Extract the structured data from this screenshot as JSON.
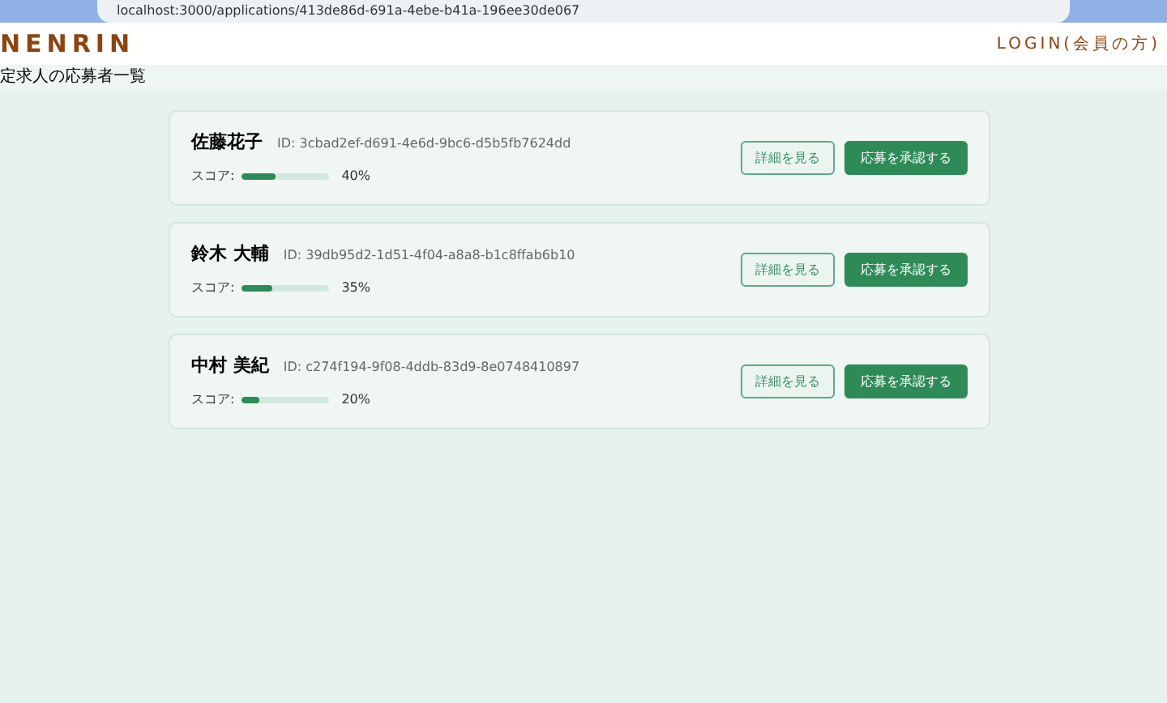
{
  "browser": {
    "url": "localhost:3000/applications/413de86d-691a-4ebe-b41a-196ee30de067"
  },
  "header": {
    "logo": "NENRIN",
    "login_link": "LOGIN(会員の方)"
  },
  "page_title": "定求人の応募者一覧",
  "applicants": [
    {
      "name": "佐藤花子",
      "id": "ID: 3cbad2ef-d691-4e6d-9bc6-d5b5fb7624dd",
      "score_label": "スコア:",
      "level": 0.4,
      "score": "40%",
      "details_button": "詳細を見る",
      "approve_button": "応募を承認する"
    },
    {
      "name": "鈴木 大輔",
      "id": "ID: 39db95d2-1d51-4f04-a8a8-b1c8ffab6b10",
      "score_label": "スコア:",
      "level": 0.35,
      "score": "35%",
      "details_button": "詳細を見る",
      "approve_button": "応募を承認する"
    },
    {
      "name": "中村 美紀",
      "id": "ID: c274f194-9f08-4ddb-83d9-8e0748410897",
      "score_label": "スコア:",
      "level": 0.2,
      "score": "20%",
      "details_button": "詳細を見る",
      "approve_button": "応募を承認する"
    }
  ]
}
